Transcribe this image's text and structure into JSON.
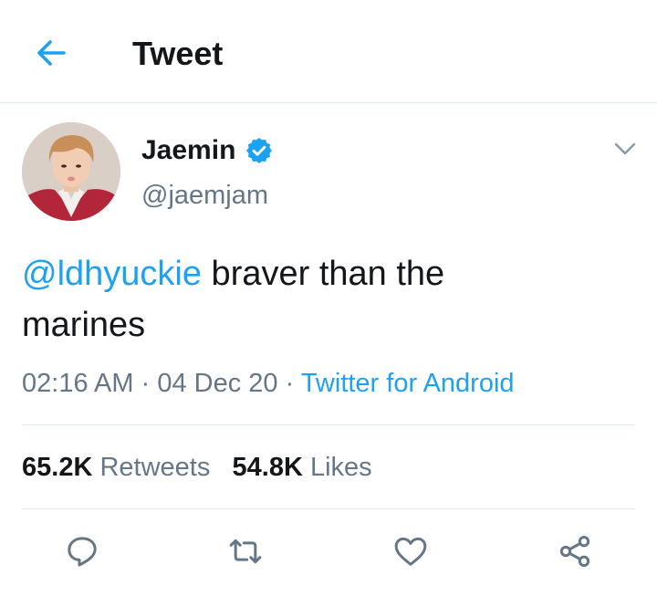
{
  "header": {
    "title": "Tweet",
    "back_icon": "arrow-left-icon"
  },
  "colors": {
    "accent": "#1da1f2",
    "secondary_text": "#657786",
    "primary_text": "#14171a",
    "divider": "#e1e8ed"
  },
  "tweet": {
    "author": {
      "display_name": "Jaemin",
      "handle": "@jaemjam",
      "verified": true
    },
    "text": {
      "mention": "@ldhyuckie",
      "body_line1": " braver than the",
      "body_line2": "marines"
    },
    "time": "02:16 AM",
    "separator": "·",
    "date": "04 Dec 20",
    "source": "Twitter for Android",
    "stats": {
      "retweets_count": "65.2K",
      "retweets_label": "Retweets",
      "likes_count": "54.8K",
      "likes_label": "Likes"
    }
  },
  "actions": [
    "reply-icon",
    "retweet-icon",
    "like-icon",
    "share-icon"
  ]
}
